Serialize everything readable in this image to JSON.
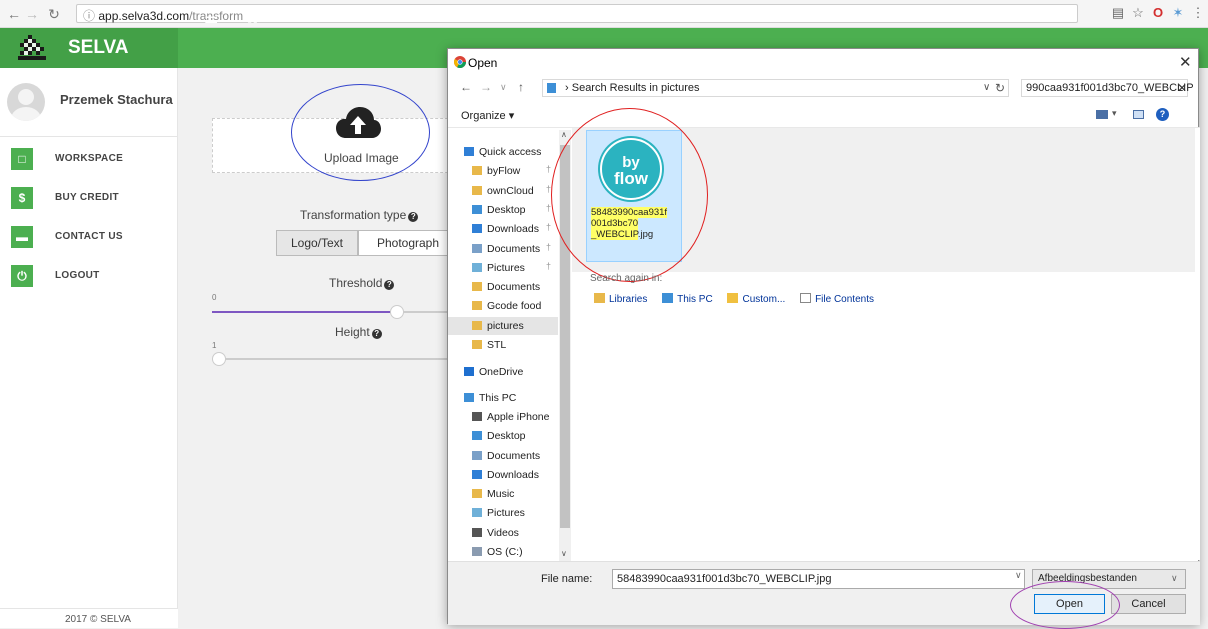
{
  "browser": {
    "url_host": "app.selva3d.com",
    "url_path": "/transform"
  },
  "app": {
    "brand": "SELVA",
    "user_name": "Przemek Stachura",
    "menu": [
      {
        "label": "WORKSPACE",
        "icon": "monitor-icon"
      },
      {
        "label": "BUY CREDIT",
        "icon": "dollar-icon"
      },
      {
        "label": "CONTACT US",
        "icon": "minus-icon"
      },
      {
        "label": "LOGOUT",
        "icon": "power-icon"
      }
    ],
    "footer": "2017 © SELVA"
  },
  "main": {
    "upload_label": "Upload Image",
    "transformation_type_label": "Transformation type",
    "type_options": [
      "Logo/Text",
      "Photograph"
    ],
    "selected_type": "Logo/Text",
    "threshold_label": "Threshold",
    "threshold_min": "0",
    "threshold_level_fraction": 0.75,
    "height_label": "Height",
    "height_min": "1"
  },
  "dialog": {
    "title": "Open",
    "address": "Search Results in pictures",
    "search_value": "990caa931f001d3bc70_WEBCLIP",
    "organize_label": "Organize",
    "nav_items": [
      {
        "label": "Quick access",
        "icon": "star-icon",
        "level": 0
      },
      {
        "label": "byFlow",
        "icon": "folder-icon",
        "level": 1,
        "pinned": true
      },
      {
        "label": "ownCloud",
        "icon": "folder-icon",
        "level": 1,
        "pinned": true
      },
      {
        "label": "Desktop",
        "icon": "desktop-folder-icon",
        "level": 1,
        "pinned": true
      },
      {
        "label": "Downloads",
        "icon": "downloads-folder-icon",
        "level": 1,
        "pinned": true
      },
      {
        "label": "Documents",
        "icon": "documents-folder-icon",
        "level": 1,
        "pinned": true
      },
      {
        "label": "Pictures",
        "icon": "pictures-folder-icon",
        "level": 1,
        "pinned": true
      },
      {
        "label": "Documents",
        "icon": "folder-icon",
        "level": 1
      },
      {
        "label": "Gcode food",
        "icon": "folder-icon",
        "level": 1
      },
      {
        "label": "pictures",
        "icon": "folder-icon",
        "level": 1,
        "selected": true
      },
      {
        "label": "STL",
        "icon": "folder-icon",
        "level": 1
      },
      {
        "label": "OneDrive",
        "icon": "onedrive-icon",
        "level": 0
      },
      {
        "label": "This PC",
        "icon": "this-pc-icon",
        "level": 0
      },
      {
        "label": "Apple iPhone",
        "icon": "phone-icon",
        "level": 1
      },
      {
        "label": "Desktop",
        "icon": "desktop-folder-icon",
        "level": 1
      },
      {
        "label": "Documents",
        "icon": "documents-folder-icon",
        "level": 1
      },
      {
        "label": "Downloads",
        "icon": "downloads-folder-icon",
        "level": 1
      },
      {
        "label": "Music",
        "icon": "music-folder-icon",
        "level": 1
      },
      {
        "label": "Pictures",
        "icon": "pictures-folder-icon",
        "level": 1
      },
      {
        "label": "Videos",
        "icon": "videos-folder-icon",
        "level": 1
      },
      {
        "label": "OS (C:)",
        "icon": "drive-icon",
        "level": 1
      }
    ],
    "file": {
      "name_line1": "58483990caa931f",
      "name_line2": "001d3bc70",
      "name_line3_hl": "_WEBCLIP",
      "name_line3_rest": ".jpg",
      "thumb_text_top": "by",
      "thumb_text_bottom": "flow"
    },
    "search_again_label": "Search again in:",
    "search_locations": [
      "Libraries",
      "This PC",
      "Custom...",
      "File Contents"
    ],
    "file_name_label": "File name:",
    "file_name_value": "58483990caa931f001d3bc70_WEBCLIP.jpg",
    "file_type_value": "Afbeeldingsbestanden",
    "open_label": "Open",
    "cancel_label": "Cancel"
  },
  "colors": {
    "brand_green": "#4caf50",
    "annotation_blue": "#3344cc",
    "annotation_red": "#e02020",
    "annotation_purple": "#a040b0"
  }
}
